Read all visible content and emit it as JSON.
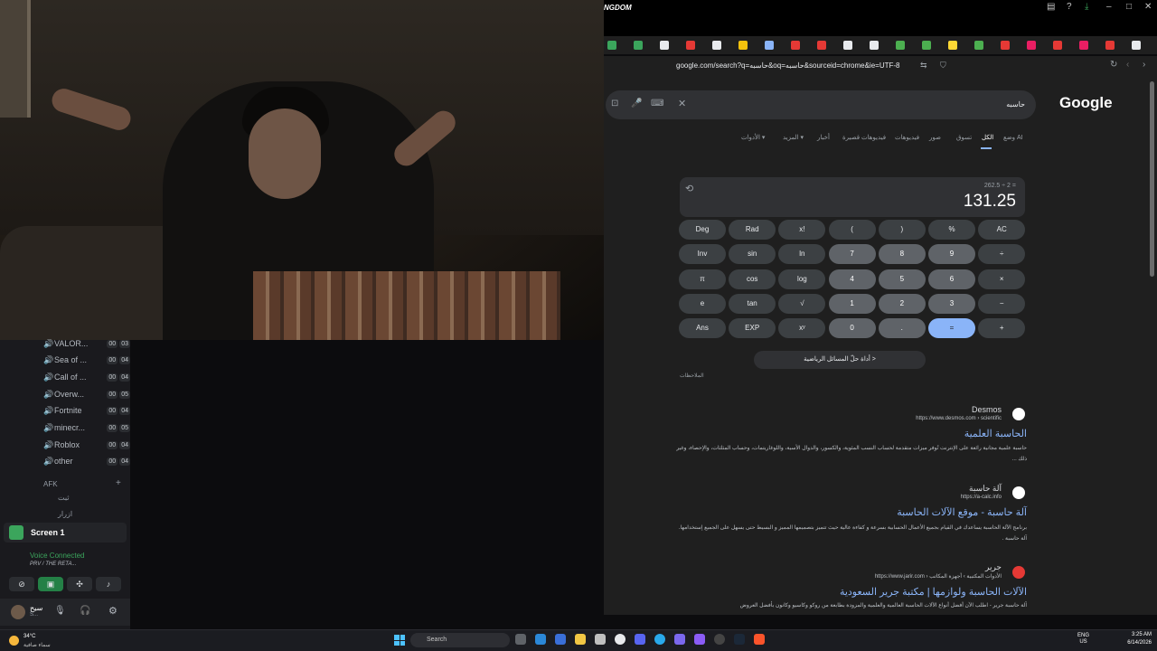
{
  "webcam": {
    "label": ""
  },
  "discord": {
    "channels": [
      {
        "name": "VALOR...",
        "c1": "00",
        "c2": "03"
      },
      {
        "name": "Sea of ...",
        "c1": "00",
        "c2": "04"
      },
      {
        "name": "Call of ...",
        "c1": "00",
        "c2": "04"
      },
      {
        "name": "Overw...",
        "c1": "00",
        "c2": "05"
      },
      {
        "name": "Fortnite",
        "c1": "00",
        "c2": "04"
      },
      {
        "name": "minecr...",
        "c1": "00",
        "c2": "05"
      },
      {
        "name": "Roblox",
        "c1": "00",
        "c2": "04"
      },
      {
        "name": "other",
        "c1": "00",
        "c2": "04"
      }
    ],
    "afk_label": "AFK",
    "afk_plus": "+",
    "sub_items": [
      "ثبت",
      "ازرار"
    ],
    "screen_label": "Screen 1",
    "voice_status": "Voice Connected",
    "voice_channel": "PRV / THE RETA...",
    "user_name": "سيح",
    "user_status": "S..."
  },
  "browser": {
    "window_title": "NGDOM",
    "url": "google.com/search?q=حاسبه&oq=حاسبه&sourceid=chrome&ie=UTF-8",
    "bookmark_colors": [
      "#3ba55c",
      "#3ba55c",
      "#e8eaed",
      "#e53935",
      "#e8eaed",
      "#f4c20d",
      "#8ab4f8",
      "#e53935",
      "#e53935",
      "#e8eaed",
      "#e8eaed",
      "#4caf50",
      "#4caf50",
      "#fdd835",
      "#4caf50",
      "#e53935",
      "#e91e63",
      "#e53935",
      "#e91e63",
      "#e53935",
      "#e8eaed"
    ]
  },
  "google": {
    "logo": "Google",
    "query": "حاسبه",
    "tabs": [
      {
        "label": "وضع AI",
        "active": false
      },
      {
        "label": "الكل",
        "active": true
      },
      {
        "label": "تسوق",
        "active": false
      },
      {
        "label": "صور",
        "active": false
      },
      {
        "label": "فيديوهات",
        "active": false
      },
      {
        "label": "فيديوهات قصيرة",
        "active": false
      },
      {
        "label": "أخبار",
        "active": false
      },
      {
        "label": "المزيد ▾",
        "active": false
      },
      {
        "label": "الأدوات ▾",
        "active": false
      }
    ],
    "calculator": {
      "expression": "262.5 ÷ 2 =",
      "result": "131.25",
      "rows": [
        [
          "Deg",
          "Rad",
          "x!",
          "(",
          ")",
          "%",
          "AC"
        ],
        [
          "Inv",
          "sin",
          "ln",
          "7",
          "8",
          "9",
          "÷"
        ],
        [
          "π",
          "cos",
          "log",
          "4",
          "5",
          "6",
          "×"
        ],
        [
          "e",
          "tan",
          "√",
          "1",
          "2",
          "3",
          "−"
        ],
        [
          "Ans",
          "EXP",
          "xʸ",
          "0",
          ".",
          "=",
          "+"
        ]
      ]
    },
    "math_button": "أداة حلّ المسائل الرياضية  >",
    "feedback": "الملاحظات",
    "results": [
      {
        "site": "Desmos",
        "url": "https://www.desmos.com › scientific",
        "title": "الحاسبة العلمية",
        "snippet": "حاسبة علمية مجانية رائعة على الإنترنت تُوفر ميزات متقدمة لحساب النسب المئوية، والكسور، والدوال الأسية، واللوغاريتمات، وحساب المثلثات، والإحصاء، وغير ذلك ..."
      },
      {
        "site": "آلة حاسبة",
        "url": "https://a-calc.info",
        "title": "آلة حاسبة - موقع الآلات الحاسبة",
        "snippet": "برنامج الآلة الحاسبة يساعدك في القيام بجميع الأعمال الحسابية بسرعة و كفاءة عالية حيث تتميز بتصميمها المميز و البسيط حتى يسهل على الجميع إستخدامها. آلة حاسبة ."
      },
      {
        "site": "جرير",
        "url": "https://www.jarir.com › الأدوات المكتبية › أجهزة المكاتب",
        "title": "الآلات الحاسبة ولوازمها | مكتبة جرير السعودية",
        "snippet": "آلة حاسبة جرير - اطلب الآن أفضل أنواع الآلات الحاسبة العالمية والعلمية والمزودة بطابعة من روكو وكاسيو وكانون بأفضل العروض"
      }
    ]
  },
  "taskbar": {
    "weather_temp": "34°C",
    "weather_desc": "سماء صافية",
    "search": "Search",
    "lang_1": "ENG",
    "lang_2": "US",
    "time": "3:25 AM",
    "date": "6/14/2026"
  }
}
